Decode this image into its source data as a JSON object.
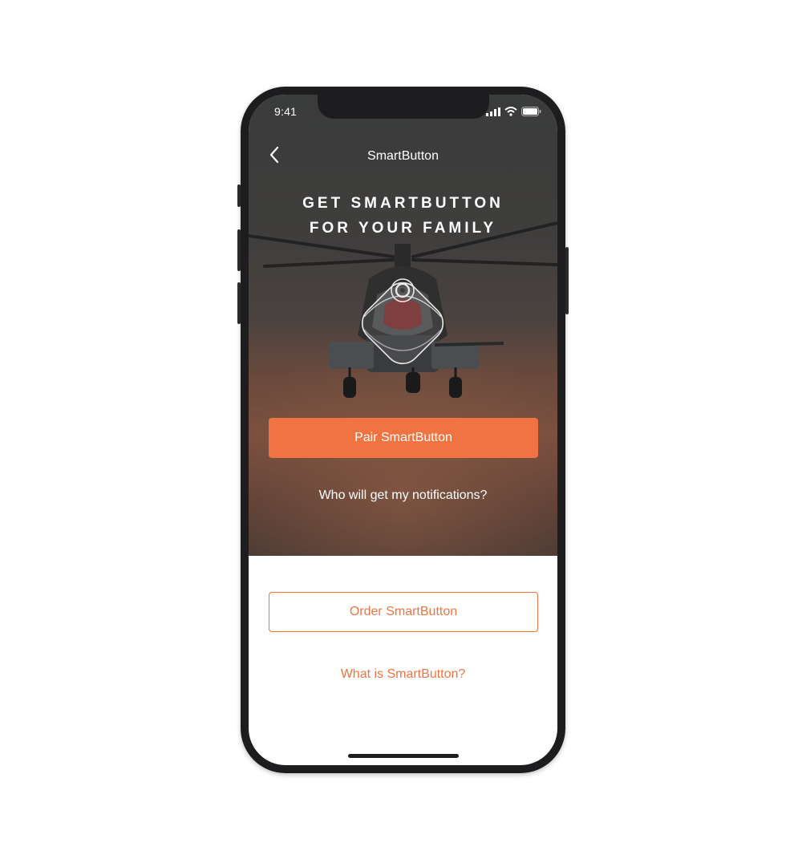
{
  "status_bar": {
    "time": "9:41"
  },
  "nav": {
    "title": "SmartButton",
    "back_icon": "chevron-left-icon"
  },
  "hero": {
    "headline_line1": "GET SMARTBUTTON",
    "headline_line2": "FOR YOUR FAMILY"
  },
  "actions": {
    "pair_label": "Pair SmartButton",
    "notifications_link": "Who will get my notifications?",
    "order_label": "Order SmartButton",
    "what_is_link": "What is SmartButton?"
  },
  "colors": {
    "accent": "#ef7442",
    "hero_dark": "#3a3b3b",
    "hero_warm": "#7a5040"
  }
}
